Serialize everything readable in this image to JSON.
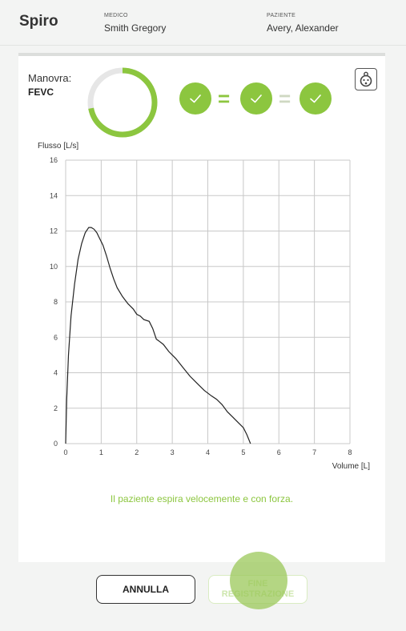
{
  "header": {
    "app_title": "Spiro",
    "doctor_label": "MEDICO",
    "doctor_name": "Smith Gregory",
    "patient_label": "PAZIENTE",
    "patient_name": "Avery, Alexander"
  },
  "maneuver": {
    "label": "Manovra:",
    "value": "FEVC",
    "progress_fraction": 0.72
  },
  "quality": {
    "checks_passed": 3,
    "separators": [
      "=",
      "="
    ]
  },
  "chart_data": {
    "type": "line",
    "title": "",
    "xlabel": "Volume [L]",
    "ylabel": "Flusso [L/s]",
    "xlim": [
      0,
      8
    ],
    "ylim": [
      0,
      16
    ],
    "x_ticks": [
      "0",
      "1",
      "2",
      "3",
      "4",
      "5",
      "6",
      "7",
      "8"
    ],
    "y_ticks": [
      "0",
      "2",
      "4",
      "6",
      "8",
      "10",
      "12",
      "14",
      "16"
    ],
    "grid": true,
    "series": [
      {
        "x": [
          0,
          0.03,
          0.08,
          0.15,
          0.25,
          0.35,
          0.45,
          0.55,
          0.65,
          0.72,
          0.8,
          0.88,
          0.95,
          1.05,
          1.15,
          1.25,
          1.35,
          1.45,
          1.6,
          1.75,
          1.9,
          2.0,
          2.1,
          2.2,
          2.35,
          2.45,
          2.55,
          2.62,
          2.75,
          2.9,
          3.1,
          3.3,
          3.5,
          3.7,
          3.9,
          4.1,
          4.25,
          4.4,
          4.55,
          4.7,
          4.85,
          5.0,
          5.1,
          5.2
        ],
        "y": [
          0,
          2.5,
          5,
          7.2,
          9,
          10.4,
          11.3,
          11.9,
          12.2,
          12.2,
          12.1,
          11.9,
          11.6,
          11.2,
          10.6,
          9.9,
          9.3,
          8.8,
          8.3,
          7.9,
          7.6,
          7.3,
          7.2,
          7.0,
          6.9,
          6.5,
          5.9,
          5.8,
          5.6,
          5.2,
          4.8,
          4.3,
          3.8,
          3.4,
          3.0,
          2.7,
          2.5,
          2.2,
          1.8,
          1.5,
          1.2,
          0.9,
          0.5,
          0
        ]
      }
    ]
  },
  "instruction": "Il paziente espira velocemente e con forza.",
  "buttons": {
    "cancel_label": "ANNULLA",
    "finish_line1": "FINE",
    "finish_line2": "REGISTRAZIONE"
  },
  "colors": {
    "accent": "#8cc63f",
    "accent_faded": "#cfd8c2",
    "ring_track": "#e6e6e6"
  },
  "icons": {
    "check": "check-icon",
    "face": "baby-face-icon"
  }
}
